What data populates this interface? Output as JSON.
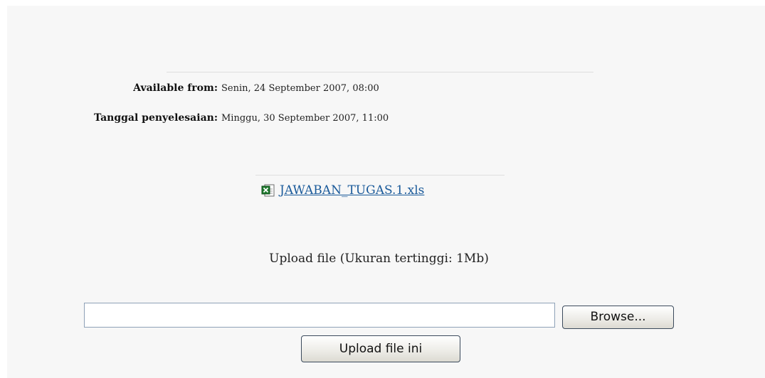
{
  "dates": {
    "available_from_label": "Available from:",
    "available_from_value": "Senin, 24 September 2007, 08:00",
    "due_label": "Tanggal penyelesaian:",
    "due_value": "Minggu, 30 September 2007, 11:00"
  },
  "attachment": {
    "icon": "excel-file-icon",
    "filename": "JAWABAN_TUGAS.1.xls"
  },
  "upload": {
    "caption": "Upload file (Ukuran tertinggi: 1Mb)",
    "file_input_value": "",
    "browse_label": "Browse...",
    "submit_label": "Upload file ini"
  },
  "colors": {
    "panel_background": "#f7f7f7",
    "link": "#1a5a9a"
  }
}
